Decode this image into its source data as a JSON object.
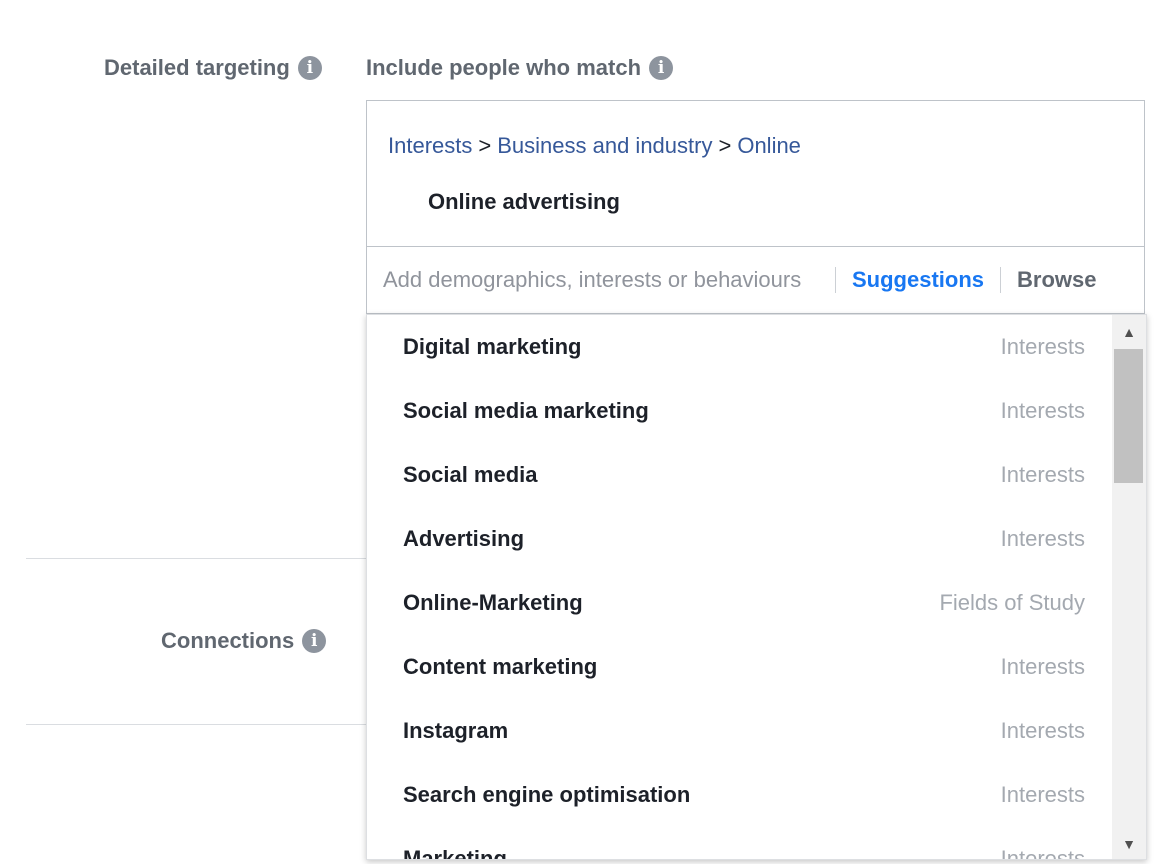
{
  "detailed_targeting": {
    "label": "Detailed targeting",
    "include_label": "Include people who match",
    "breadcrumb": [
      "Interests",
      "Business and industry",
      "Online"
    ],
    "breadcrumb_separator": ">",
    "selected_item": "Online advertising",
    "search_placeholder": "Add demographics, interests or behaviours",
    "search_value": "",
    "suggestions_label": "Suggestions",
    "browse_label": "Browse"
  },
  "connections": {
    "label": "Connections"
  },
  "dropdown": {
    "items": [
      {
        "name": "Digital marketing",
        "category": "Interests"
      },
      {
        "name": "Social media marketing",
        "category": "Interests"
      },
      {
        "name": "Social media",
        "category": "Interests"
      },
      {
        "name": "Advertising",
        "category": "Interests"
      },
      {
        "name": "Online-Marketing",
        "category": "Fields of Study"
      },
      {
        "name": "Content marketing",
        "category": "Interests"
      },
      {
        "name": "Instagram",
        "category": "Interests"
      },
      {
        "name": "Search engine optimisation",
        "category": "Interests"
      },
      {
        "name": "Marketing",
        "category": "Interests"
      }
    ]
  },
  "icons": {
    "info": "info-icon",
    "scroll_up": "scroll-up-arrow-icon",
    "scroll_down": "scroll-down-arrow-icon"
  },
  "colors": {
    "link": "#365899",
    "accent": "#1877f2",
    "label_gray": "#606770",
    "category_gray": "#a4a9b0"
  }
}
